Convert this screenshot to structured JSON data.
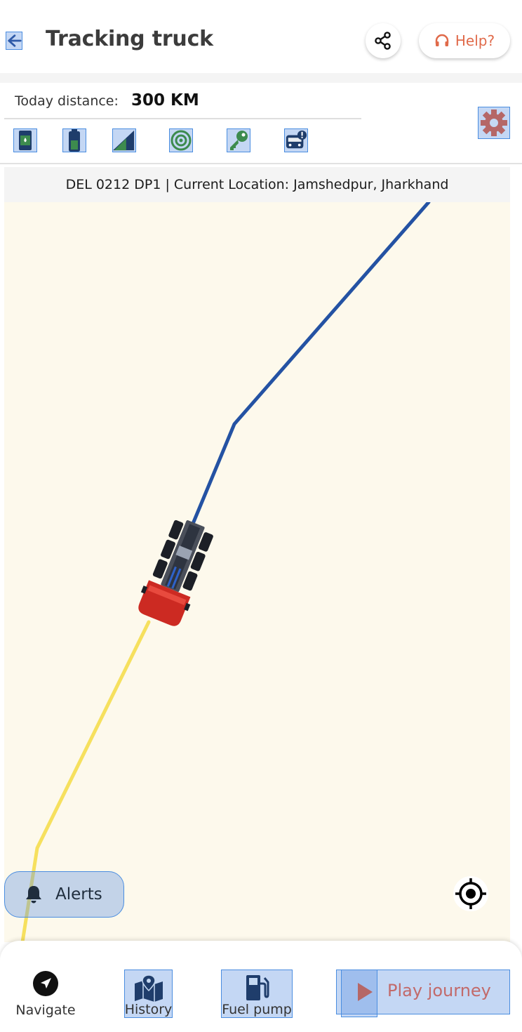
{
  "header": {
    "title": "Tracking truck",
    "help_label": "Help?"
  },
  "status": {
    "distance_label": "Today distance:",
    "distance_value": "300 KM",
    "status_icons": [
      "fuel-icon",
      "battery-icon",
      "signal-icon",
      "gps-icon",
      "ignition-key-icon",
      "vehicle-alert-icon"
    ]
  },
  "location_banner": "DEL 0212 DP1 | Current Location: Jamshedpur, Jharkhand",
  "map": {
    "route_ahead_color": "#2452a3",
    "route_travelled_color": "#f6e05e",
    "map_background": "#fdf9ec"
  },
  "alerts": {
    "label": "Alerts"
  },
  "bottom_nav": {
    "navigate": "Navigate",
    "history": "History",
    "fuel_pump": "Fuel pump",
    "play_journey": "Play journey"
  },
  "colors": {
    "accent": "#e06a4a",
    "highlight": "#4a8de0"
  }
}
